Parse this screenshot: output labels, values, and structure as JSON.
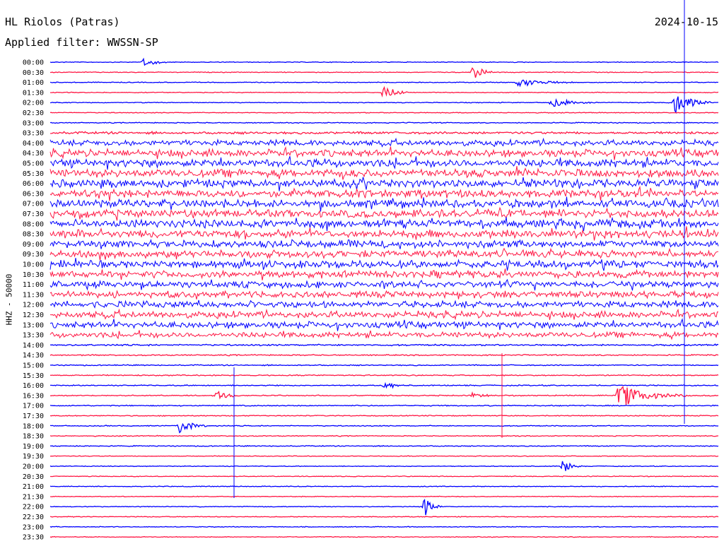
{
  "header": {
    "station": "HL Riolos (Patras)",
    "filter": "Applied filter: WWSSN-SP",
    "date": "2024-10-15"
  },
  "chart_data": {
    "type": "line",
    "title": "HL Riolos (Patras)",
    "subtitle": "Applied filter: WWSSN-SP",
    "date": "2024-10-15",
    "ylabel": "HHZ - 50000",
    "xlabel": "",
    "row_labels": [
      "00:00",
      "00:30",
      "01:00",
      "01:30",
      "02:00",
      "02:30",
      "03:00",
      "03:30",
      "04:00",
      "04:30",
      "05:00",
      "05:30",
      "06:00",
      "06:30",
      "07:00",
      "07:30",
      "08:00",
      "08:30",
      "09:00",
      "09:30",
      "10:00",
      "10:30",
      "11:00",
      "11:30",
      "12:00",
      "12:30",
      "13:00",
      "13:30",
      "14:00",
      "14:30",
      "15:00",
      "15:30",
      "16:00",
      "16:30",
      "17:00",
      "17:30",
      "18:00",
      "18:30",
      "19:00",
      "19:30",
      "20:00",
      "20:30",
      "21:00",
      "21:30",
      "22:00",
      "22:30",
      "23:00",
      "23:30"
    ],
    "row_colors": [
      "#0000ff",
      "#ff1744"
    ],
    "row_minutes": 30,
    "noise_level": [
      0.5,
      0.5,
      0.5,
      0.5,
      0.5,
      0.5,
      0.6,
      1.5,
      3.5,
      4.5,
      5,
      5,
      5,
      5,
      5,
      5,
      5,
      5,
      4.5,
      4.5,
      4.5,
      4.5,
      4,
      4,
      4,
      4,
      4,
      3.5,
      1,
      0.8,
      0.7,
      0.7,
      0.7,
      0.7,
      0.7,
      0.6,
      0.6,
      0.6,
      0.6,
      0.5,
      0.5,
      0.5,
      0.5,
      0.5,
      0.5,
      0.5,
      0.5,
      0.5
    ],
    "events": [
      {
        "row": 0,
        "minute": 4.2,
        "amplitude": 10,
        "duration": 1.0
      },
      {
        "row": 1,
        "minute": 19.0,
        "amplitude": 20,
        "duration": 0.8
      },
      {
        "row": 2,
        "minute": 21.0,
        "amplitude": 8,
        "duration": 2.5
      },
      {
        "row": 3,
        "minute": 15.0,
        "amplitude": 20,
        "duration": 1.0
      },
      {
        "row": 4,
        "minute": 22.5,
        "amplitude": 9,
        "duration": 2.0
      },
      {
        "row": 4,
        "minute": 28.0,
        "amplitude": 24,
        "duration": 1.6
      },
      {
        "row": 32,
        "minute": 15.0,
        "amplitude": 12,
        "duration": 0.8
      },
      {
        "row": 33,
        "minute": 7.5,
        "amplitude": 10,
        "duration": 1.0
      },
      {
        "row": 33,
        "minute": 19.0,
        "amplitude": 7,
        "duration": 0.8
      },
      {
        "row": 33,
        "minute": 25.5,
        "amplitude": 20,
        "duration": 3.0
      },
      {
        "row": 36,
        "minute": 5.8,
        "amplitude": 15,
        "duration": 1.2
      },
      {
        "row": 40,
        "minute": 23.0,
        "amplitude": 14,
        "duration": 0.8
      },
      {
        "row": 44,
        "minute": 16.8,
        "amplitude": 16,
        "duration": 0.8
      }
    ]
  }
}
